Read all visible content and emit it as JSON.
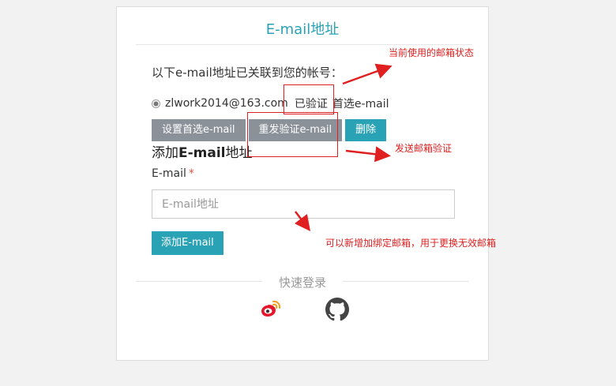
{
  "page": {
    "title": "E-mail地址"
  },
  "linked": {
    "text": "以下e-mail地址已关联到您的帐号："
  },
  "email_row": {
    "address": "zlwork2014@163.com",
    "status": "已验证",
    "primary": "首选e-mail"
  },
  "actions": {
    "set_primary": "设置首选e-mail",
    "resend": "重发验证e-mail",
    "delete": "删除"
  },
  "add": {
    "heading_prefix": "添加",
    "heading_bold": "E-mail",
    "heading_suffix": "地址",
    "label": "E-mail",
    "required_mark": "*",
    "input_value": "",
    "input_placeholder": "E-mail地址",
    "button": "添加E-mail"
  },
  "quick_login": {
    "label": "快速登录",
    "providers": [
      "weibo-icon",
      "github-icon"
    ]
  },
  "annotations": {
    "status_note": "当前使用的邮箱状态",
    "resend_note": "发送邮箱验证",
    "add_note": "可以新增加绑定邮箱，用于更换无效邮箱"
  },
  "colors": {
    "accent": "#2aa2b5",
    "annotation": "#e02020",
    "weibo": "#e6162d"
  }
}
